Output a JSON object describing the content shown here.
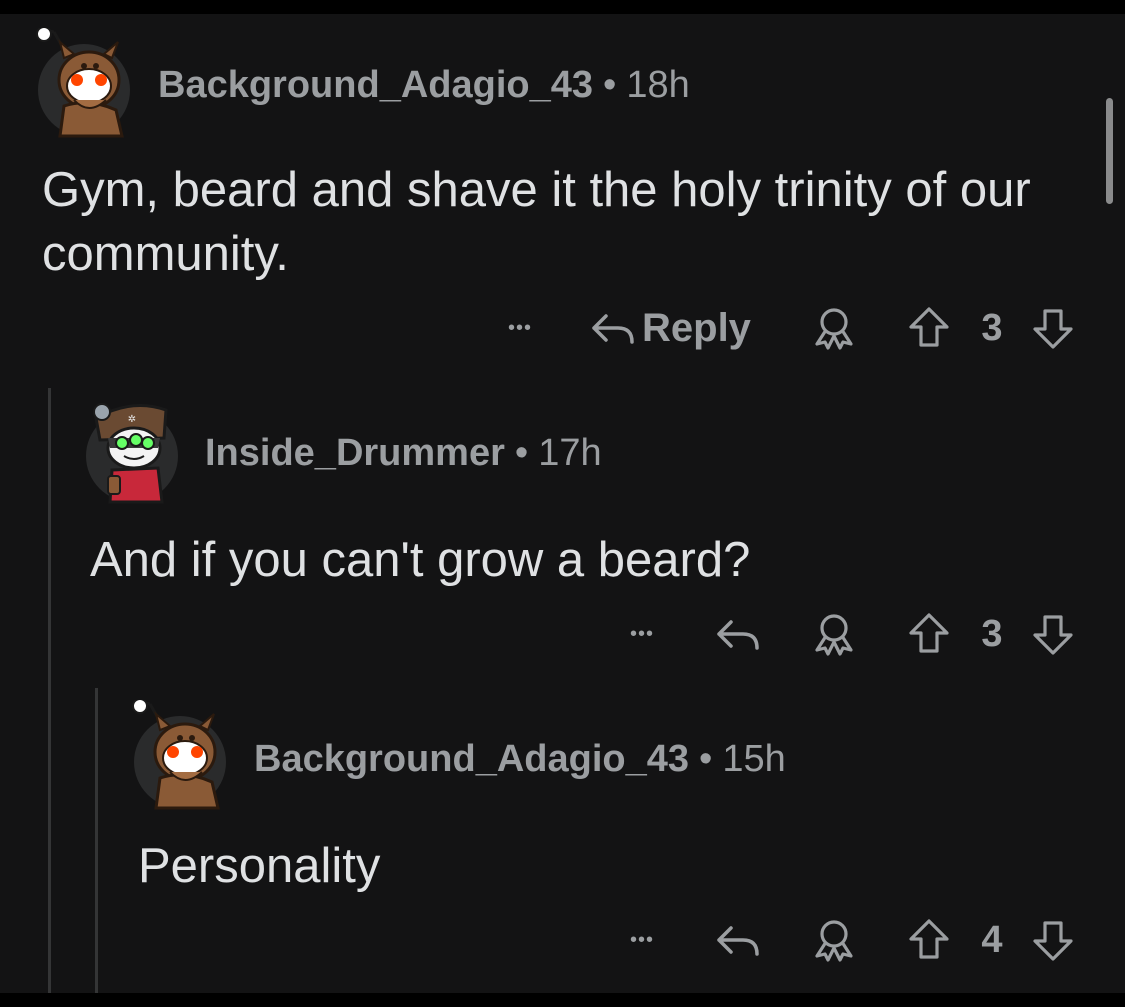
{
  "comments": [
    {
      "username": "Background_Adagio_43",
      "separator": "•",
      "time": "18h",
      "body": "Gym, beard and shave it the holy trinity of our community.",
      "more_label": "•••",
      "reply_label": "Reply",
      "votes": "3"
    },
    {
      "username": "Inside_Drummer",
      "separator": "•",
      "time": "17h",
      "body": "And if you can't grow a beard?",
      "more_label": "•••",
      "votes": "3"
    },
    {
      "username": "Background_Adagio_43",
      "separator": "•",
      "time": "15h",
      "body": "Personality",
      "more_label": "•••",
      "votes": "4"
    }
  ],
  "icons": {
    "reply": "reply-arrow-icon",
    "award": "award-icon",
    "upvote": "upvote-arrow-icon",
    "downvote": "downvote-arrow-icon",
    "more": "more-options-icon"
  },
  "colors": {
    "background": "#131314",
    "text": "#dfe1e3",
    "meta": "#9b9ea1",
    "thread_line": "#343536"
  }
}
